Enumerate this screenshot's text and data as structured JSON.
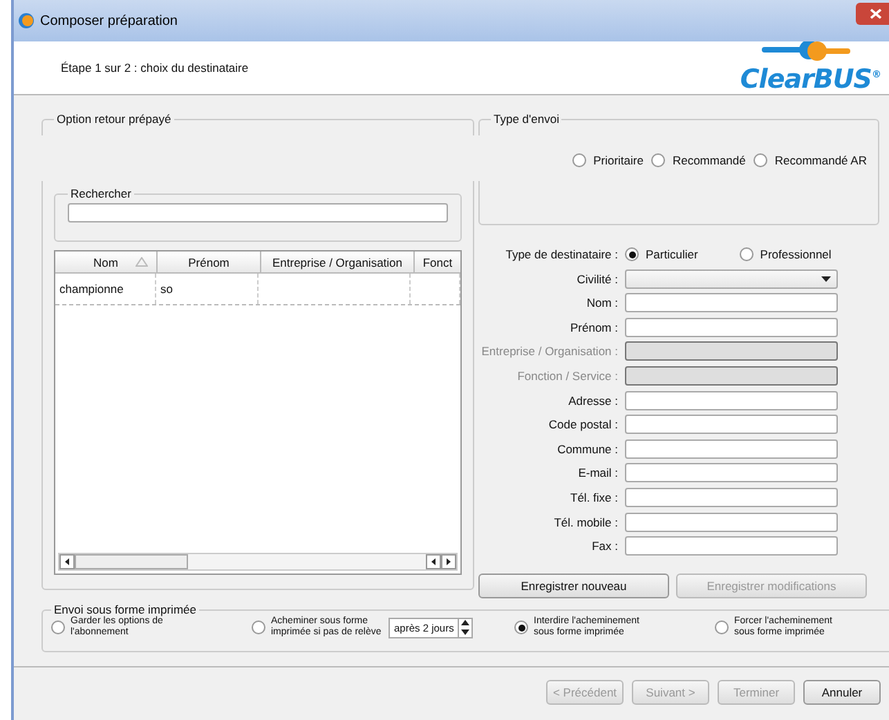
{
  "window": {
    "title": "Composer préparation"
  },
  "header": {
    "step": "Étape 1 sur 2 : choix du destinataire",
    "logo": "ClearBUS",
    "logo_mark": "®"
  },
  "option_retour": {
    "title": "Option retour prépayé"
  },
  "type_envoi": {
    "title": "Type d'envoi",
    "options": [
      {
        "label": "Prioritaire",
        "selected": false
      },
      {
        "label": "Recommandé",
        "selected": false
      },
      {
        "label": "Recommandé AR",
        "selected": false
      }
    ]
  },
  "search": {
    "title": "Rechercher"
  },
  "table": {
    "columns": [
      {
        "label": "Nom",
        "sorted": true
      },
      {
        "label": "Prénom",
        "sorted": false
      },
      {
        "label": "Entreprise / Organisation",
        "sorted": false
      },
      {
        "label": "Fonct",
        "sorted": false
      }
    ],
    "rows": [
      {
        "cells": [
          "championne",
          "so",
          "",
          ""
        ]
      }
    ]
  },
  "recipient_type": {
    "label": "Type de destinataire :",
    "options": [
      {
        "label": "Particulier",
        "selected": true
      },
      {
        "label": "Professionnel",
        "selected": false
      }
    ]
  },
  "fields": [
    {
      "label": "Civilité :",
      "kind": "combo",
      "disabled": false
    },
    {
      "label": "Nom :",
      "kind": "text",
      "disabled": false
    },
    {
      "label": "Prénom :",
      "kind": "text",
      "disabled": false
    },
    {
      "label": "Entreprise / Organisation :",
      "kind": "text",
      "disabled": true
    },
    {
      "label": "Fonction / Service :",
      "kind": "text",
      "disabled": true
    },
    {
      "label": "Adresse :",
      "kind": "text",
      "disabled": false
    },
    {
      "label": "Code postal :",
      "kind": "text",
      "disabled": false
    },
    {
      "label": "Commune :",
      "kind": "text",
      "disabled": false
    },
    {
      "label": "E-mail :",
      "kind": "text",
      "disabled": false
    },
    {
      "label": "Tél. fixe :",
      "kind": "text",
      "disabled": false
    },
    {
      "label": "Tél. mobile :",
      "kind": "text",
      "disabled": false
    },
    {
      "label": "Fax :",
      "kind": "text",
      "disabled": false
    }
  ],
  "form_buttons": [
    {
      "label": "Enregistrer nouveau",
      "disabled": false
    },
    {
      "label": "Enregistrer modifications",
      "disabled": true
    }
  ],
  "printed": {
    "title": "Envoi sous forme imprimée",
    "options": [
      {
        "label": "Garder les options de l'abonnement",
        "selected": false
      },
      {
        "label": "Acheminer sous forme imprimée si pas de relève",
        "selected": false,
        "spin_value": "après 2 jours"
      },
      {
        "label": "Interdire l'acheminement sous forme imprimée",
        "selected": true
      },
      {
        "label": "Forcer l'acheminement sous forme imprimée",
        "selected": false
      }
    ]
  },
  "footer_buttons": [
    {
      "label": "< Précédent",
      "disabled": true
    },
    {
      "label": "Suivant >",
      "disabled": true
    },
    {
      "label": "Terminer",
      "disabled": true
    },
    {
      "label": "Annuler",
      "disabled": false
    }
  ]
}
